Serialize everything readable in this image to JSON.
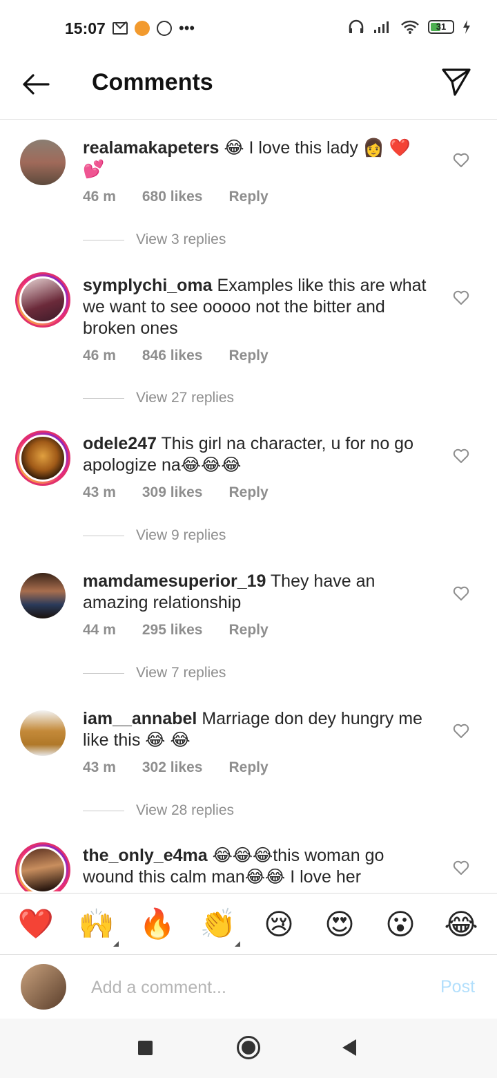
{
  "status_bar": {
    "time": "15:07",
    "battery": "31",
    "icons": [
      "gmail-icon",
      "notification-icon",
      "whatsapp-icon",
      "more-icon",
      "headphones-icon",
      "signal-icon",
      "wifi-icon",
      "battery-icon",
      "charging-icon"
    ]
  },
  "header": {
    "title": "Comments"
  },
  "comments": [
    {
      "username": "realamakapeters",
      "text": "😂 I love this lady 👩 ❤️ 💕",
      "time": "46 m",
      "likes": "680 likes",
      "reply": "Reply",
      "replies": "View 3 replies"
    },
    {
      "username": "symplychi_oma",
      "text": "Examples like this are what we want to see ooooo not the bitter and broken ones",
      "time": "46 m",
      "likes": "846 likes",
      "reply": "Reply",
      "replies": "View 27 replies"
    },
    {
      "username": "odele247",
      "text": "This girl na character, u for no go apologize na😂😂😂",
      "time": "43 m",
      "likes": "309 likes",
      "reply": "Reply",
      "replies": "View 9 replies"
    },
    {
      "username": "mamdamesuperior_19",
      "text": "They have an amazing relationship",
      "time": "44 m",
      "likes": "295 likes",
      "reply": "Reply",
      "replies": "View 7 replies"
    },
    {
      "username": "iam__annabel",
      "text": "Marriage don dey hungry me like this 😂 😂",
      "time": "43 m",
      "likes": "302 likes",
      "reply": "Reply",
      "replies": "View 28 replies"
    },
    {
      "username": "the_only_e4ma",
      "text": "😂😂😂this woman go wound this calm man😂😂 I love her",
      "time": "",
      "likes": "",
      "reply": "",
      "replies": ""
    }
  ],
  "emoji_bar": [
    "❤️",
    "🙌",
    "🔥",
    "👏",
    "😢",
    "😍",
    "😮",
    "😂"
  ],
  "comment_input": {
    "placeholder": "Add a comment...",
    "post_label": "Post"
  },
  "colors": {
    "post_disabled": "#b2dffc",
    "meta_gray": "#8e8e8e",
    "story_ring": "#e1306c"
  }
}
